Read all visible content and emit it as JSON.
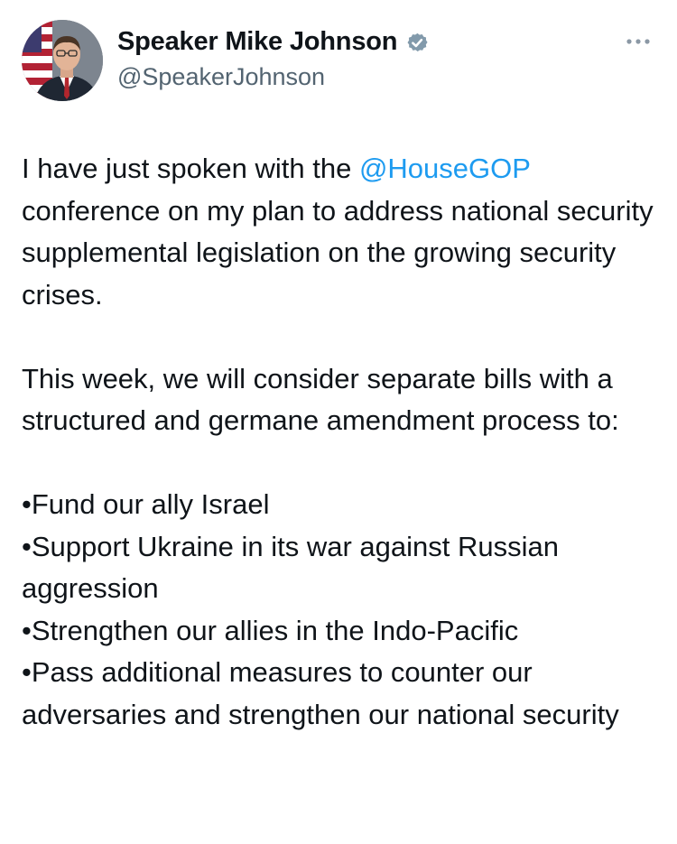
{
  "colors": {
    "text": "#0f1419",
    "secondary_text": "#536471",
    "link": "#1d9bf0",
    "verified_badge": "#829aab"
  },
  "author": {
    "display_name": "Speaker Mike Johnson",
    "handle": "@SpeakerJohnson",
    "verified_icon": "verified-badge-icon",
    "avatar_icon": "profile-photo"
  },
  "menu": {
    "icon": "more-horizontal-icon"
  },
  "tweet": {
    "p1_before": "I have just spoken with the ",
    "p1_mention": "@HouseGOP",
    "p1_after": " conference on my plan to address national security supplemental legislation on the growing security crises.",
    "p2": "This week, we will consider separate bills with a structured and germane amendment process to:",
    "bullets": [
      "•Fund our ally Israel",
      "•Support Ukraine in its war against Russian aggression",
      "•Strengthen our allies in the Indo-Pacific",
      "•Pass additional measures to counter our adversaries and strengthen our national security"
    ]
  }
}
